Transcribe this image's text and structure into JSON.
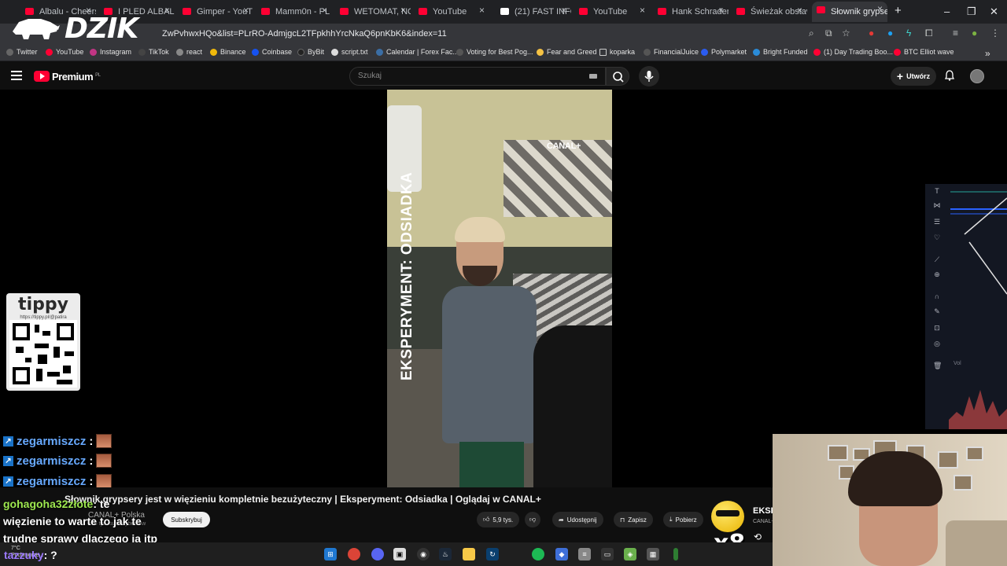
{
  "browser": {
    "tabs": [
      {
        "label": "Albalu - Cheers"
      },
      {
        "label": "I PLED ALBALU"
      },
      {
        "label": "Gimper - YouT"
      },
      {
        "label": "Mamm0n - PL"
      },
      {
        "label": "WETOMAT, NO"
      },
      {
        "label": "YouTube"
      },
      {
        "label": "(21) FAST INFO"
      },
      {
        "label": "YouTube"
      },
      {
        "label": "Hank Schrader"
      },
      {
        "label": "Świeżak obstaw"
      },
      {
        "label": "Słownik grypse"
      }
    ],
    "new_tab": "+",
    "url": "ZwPvhwxHQo&list=PLrRO-AdmjgcL2TFpkhhYrcNkaQ6pnKbK6&index=11",
    "bookmarks": [
      {
        "label": "Twitter"
      },
      {
        "label": "YouTube"
      },
      {
        "label": "Instagram"
      },
      {
        "label": "TikTok"
      },
      {
        "label": "react"
      },
      {
        "label": "Binance"
      },
      {
        "label": "Coinbase"
      },
      {
        "label": "ByBit"
      },
      {
        "label": "script.txt"
      },
      {
        "label": "Calendar | Forex Fac..."
      },
      {
        "label": "Voting for Best Pog..."
      },
      {
        "label": "Fear and Greed"
      },
      {
        "label": "koparka"
      },
      {
        "label": "FinancialJuice"
      },
      {
        "label": "Polymarket"
      },
      {
        "label": "Bright Funded"
      },
      {
        "label": "(1) Day Trading Boo..."
      },
      {
        "label": "BTC Elliot wave"
      }
    ]
  },
  "overlay": {
    "logo": "DZIK",
    "tippy_logo": "tippy",
    "tippy_url": "https://tippy.pl/@patira"
  },
  "youtube": {
    "brand": "Premium",
    "brand_region": "PL",
    "search_placeholder": "Szukaj",
    "create_label": "Utwórz",
    "video_overlay_text": "EKSPERYMENT: ODSIADKA",
    "video_watermark": "CANAL+",
    "video_title": "Słownik grypsery jest w więzieniu kompletnie bezużyteczny | Eksperyment: Odsiadka | Oglądaj w CANAL+",
    "channel": "CANAL+ Polska",
    "subscribers": "206 tys. subskrybentów",
    "subscribe_label": "Subskrybuj",
    "like_count": "5,9 tys.",
    "share_label": "Udostępnij",
    "save_label": "Zapisz",
    "download_label": "Pobierz",
    "miniplayer_title": "EKSP",
    "miniplayer_channel": "CANAL+"
  },
  "chat": [
    {
      "user": "zegarmiszcz",
      "text": ":"
    },
    {
      "user": "zegarmiszcz",
      "text": ":"
    },
    {
      "user": "zegarmiszcz",
      "text": ":"
    }
  ],
  "chat_long": {
    "user": "gohagoha32złote",
    "text": ": te więzienie to warte to jak te trudne sprawy dlaczego ja itp"
  },
  "chat_last": {
    "user": "tazzuky",
    "text": ": ?"
  },
  "emote_combo": "x8",
  "trading": {
    "volume_label": "Vol"
  },
  "weather": {
    "temp": "7°C",
    "desc": "Pochmurze..."
  },
  "colors": {
    "accent": "#ff0033",
    "chat_user": "#67a9ff",
    "chat_user2": "#9ee84f",
    "chat_user3": "#9d7bff"
  }
}
